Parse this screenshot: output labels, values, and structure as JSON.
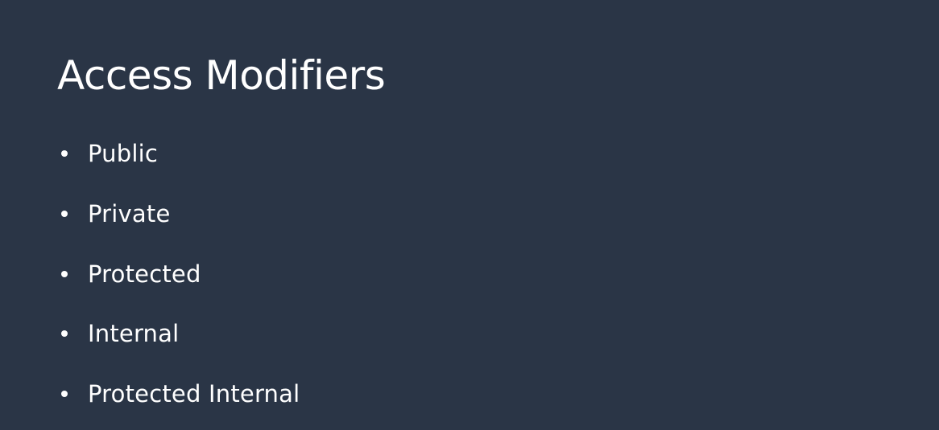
{
  "slide": {
    "title": "Access Modifiers",
    "bullets": [
      "Public",
      "Private",
      "Protected",
      "Internal",
      "Protected Internal"
    ]
  },
  "colors": {
    "background": "#2a3546",
    "text": "#ffffff"
  },
  "icons": {
    "bullet": "bullet-dot-icon"
  }
}
